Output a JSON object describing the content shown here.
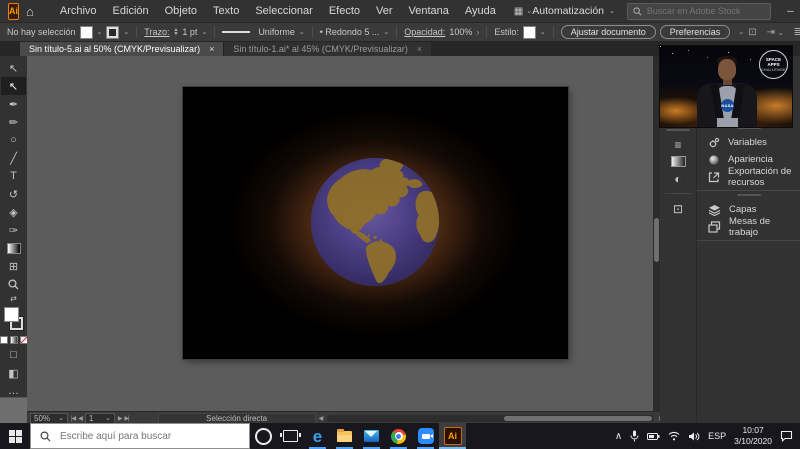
{
  "menubar": {
    "logo_text": "Ai",
    "home_glyph": "⌂",
    "items": [
      "Archivo",
      "Edición",
      "Objeto",
      "Texto",
      "Seleccionar",
      "Efecto",
      "Ver",
      "Ventana",
      "Ayuda"
    ],
    "workspace_switcher_glyph": "▦",
    "workspace": "Automatización",
    "search_placeholder": "Buscar en Adobe Stock",
    "window": {
      "minimize": "─",
      "restore": "☐",
      "close": "×"
    }
  },
  "controlbar": {
    "selection_status": "No hay selección",
    "stroke_label": "Trazo:",
    "stroke_value": "1 pt",
    "profile_value": "Uniforme",
    "brush_value": "• Redondo 5 ...",
    "opacity_label": "Opacidad:",
    "opacity_value": "100%",
    "expander": "›",
    "style_label": "Estilo:",
    "fit_document_button": "Ajustar documento",
    "preferences_button": "Preferencias"
  },
  "tabs": [
    {
      "label": "Sin título-5.ai al 50% (CMYK/Previsualizar)"
    },
    {
      "label": "Sin título-1.ai* al 45% (CMYK/Previsualizar)"
    }
  ],
  "toolbar": {
    "tools": [
      {
        "name": "selection-tool",
        "glyph": "↖"
      },
      {
        "name": "direct-selection-tool",
        "glyph": "↖"
      },
      {
        "name": "pen-tool",
        "glyph": "✒"
      },
      {
        "name": "curvature-tool",
        "glyph": "✏"
      },
      {
        "name": "ellipse-tool",
        "glyph": "○"
      },
      {
        "name": "paintbrush-tool",
        "glyph": "╱"
      },
      {
        "name": "type-tool",
        "glyph": "T"
      },
      {
        "name": "rotate-tool",
        "glyph": "↺"
      },
      {
        "name": "shape-builder-tool",
        "glyph": "◈"
      },
      {
        "name": "blob-brush-tool",
        "glyph": "✑"
      },
      {
        "name": "artboard-tool",
        "glyph": "⊞"
      },
      {
        "name": "swap-colors",
        "glyph": "⇄"
      },
      {
        "name": "draw-mode",
        "glyph": "□"
      },
      {
        "name": "screen-mode",
        "glyph": "◧"
      },
      {
        "name": "more-tools",
        "glyph": "…"
      }
    ]
  },
  "status_bar": {
    "zoom_level": "50%",
    "nav_first": "|◀",
    "nav_prev": "◀",
    "artboard_field": "1",
    "nav_next": "▶",
    "nav_last": "▶|",
    "tool_name": "Selección directa",
    "scroll_left": "◀",
    "scroll_right": "▶"
  },
  "dock": {
    "strip": [
      {
        "name": "stroke-panel-icon",
        "glyph": "≡"
      },
      {
        "name": "transparency-panel-icon",
        "glyph": "◐"
      },
      {
        "name": "symbols-panel-icon",
        "glyph": "⊡"
      }
    ],
    "groups": [
      {
        "items": [
          {
            "label": "Variables"
          },
          {
            "label": "Apariencia"
          },
          {
            "label": "Exportación de recursos"
          }
        ]
      },
      {
        "items": [
          {
            "label": "Capas"
          },
          {
            "label": "Mesas de trabajo"
          }
        ]
      }
    ]
  },
  "webcam": {
    "badge_line1": "SPACE APPS",
    "badge_line2": "CHALLENGE",
    "shirt_logo": "NASA"
  },
  "taskbar": {
    "search_placeholder": "Escribe aquí para buscar",
    "language": "ESP",
    "time": "10:07",
    "date": "3/10/2020"
  },
  "icons": {
    "chevron": "⌄",
    "close": "×",
    "tray_expand": "∧"
  },
  "colors": {
    "accent_orange": "#ff9a00",
    "taskbar_running_underline": "#4da3ff",
    "artboard_glow": "#a05a2a",
    "ocean": "#4a4186",
    "land": "#8f7130"
  }
}
